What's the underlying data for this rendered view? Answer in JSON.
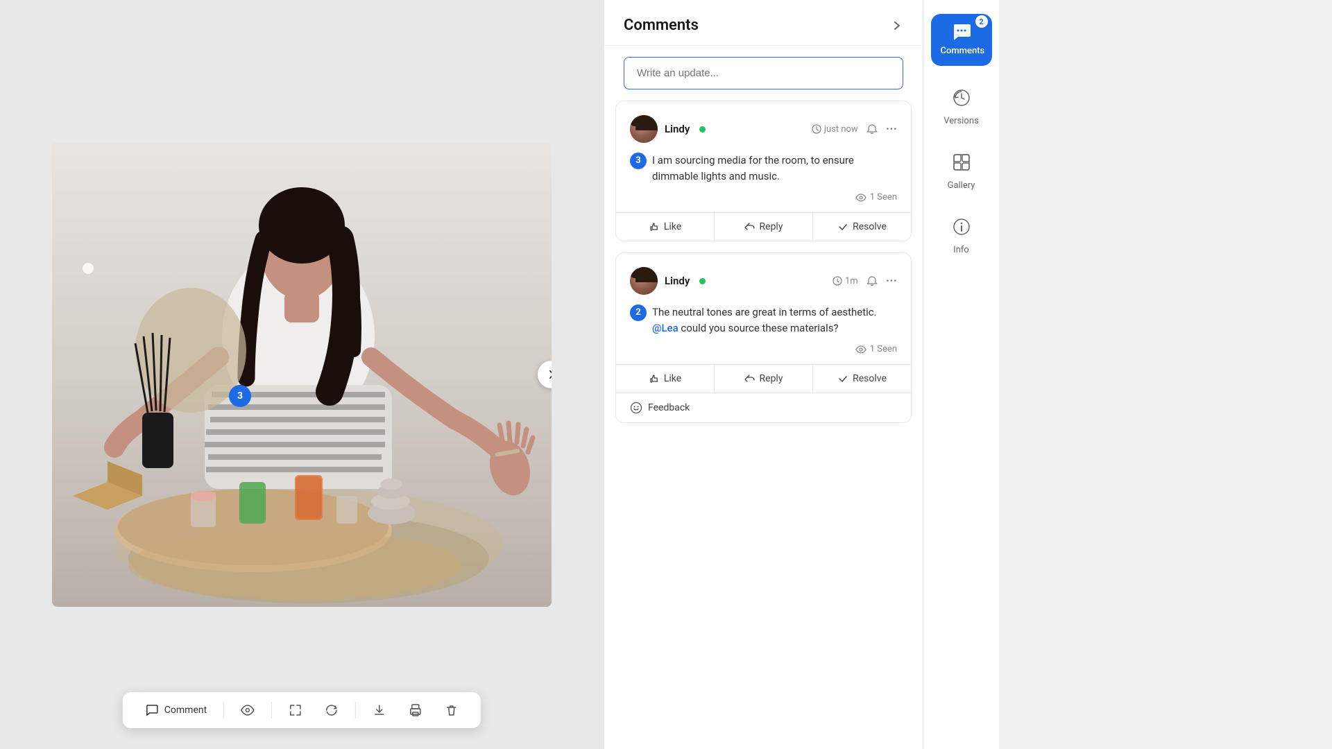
{
  "image": {
    "alt": "Meditation room with candles and decorative items",
    "annotation_dot": "3"
  },
  "toolbar": {
    "comment_label": "Comment",
    "items": [
      "comment",
      "eye",
      "expand",
      "refresh",
      "download",
      "print",
      "trash"
    ]
  },
  "comments_panel": {
    "title": "Comments",
    "write_placeholder": "Write an update...",
    "comments": [
      {
        "id": "comment-1",
        "user": "Lindy",
        "online": true,
        "time": "just now",
        "badge_number": "3",
        "text": "I am sourcing media for the room, to ensure dimmable lights and music.",
        "seen_count": "1 Seen",
        "actions": [
          "Like",
          "Reply",
          "Resolve"
        ]
      },
      {
        "id": "comment-2",
        "user": "Lindy",
        "online": true,
        "time": "1m",
        "badge_number": "2",
        "text_parts": [
          "The neutral tones are great in terms of aesthetic.",
          " @Lea",
          " could you source these materials?"
        ],
        "mention": "@Lea",
        "seen_count": "1 Seen",
        "actions": [
          "Like",
          "Reply",
          "Resolve"
        ],
        "has_feedback": true,
        "feedback_label": "Feedback"
      }
    ]
  },
  "right_sidebar": {
    "items": [
      {
        "id": "comments",
        "label": "Comments",
        "badge": "2",
        "active": true
      },
      {
        "id": "versions",
        "label": "Versions",
        "active": false
      },
      {
        "id": "gallery",
        "label": "Gallery",
        "active": false
      },
      {
        "id": "info",
        "label": "Info",
        "active": false
      }
    ]
  },
  "colors": {
    "accent_blue": "#1d6ae5",
    "online_green": "#22c55e",
    "border": "#e8e8e8",
    "text_primary": "#1a1a1a",
    "text_secondary": "#666666"
  }
}
